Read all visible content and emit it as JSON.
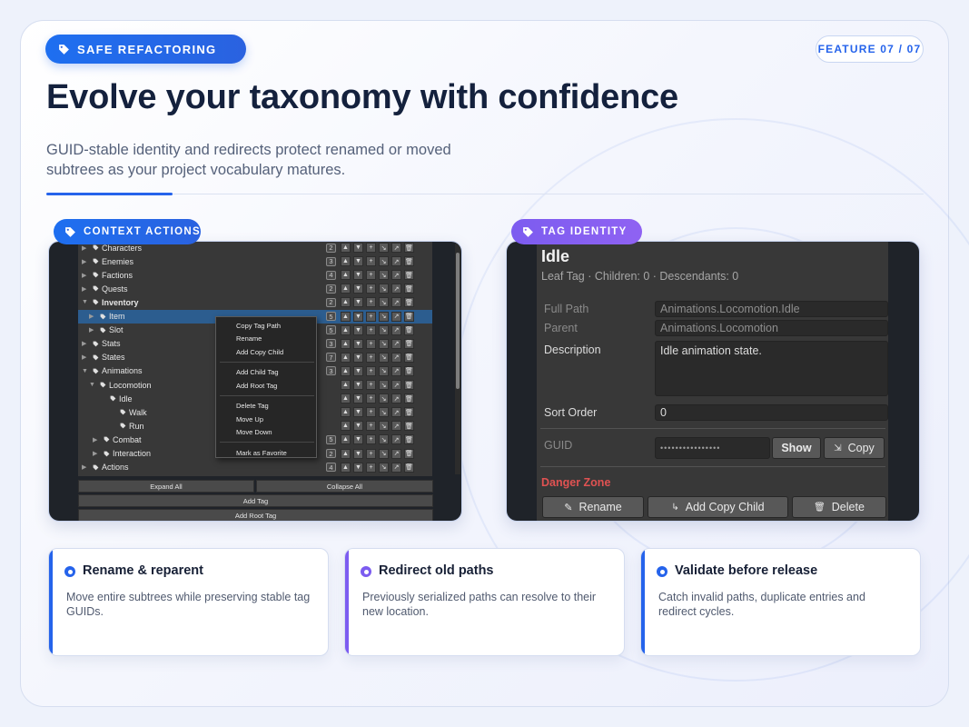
{
  "header": {
    "badge": "SAFE REFACTORING",
    "feature": "FEATURE 07 / 07",
    "title": "Evolve your taxonomy with confidence",
    "subtitle": "GUID-stable identity and redirects protect renamed or moved subtrees as your project vocabulary matures."
  },
  "colors": {
    "accent_blue": "#2563eb",
    "accent_purple": "#7c5cf0",
    "danger": "#e05252"
  },
  "left_panel": {
    "label": "CONTEXT ACTIONS",
    "tree": [
      {
        "name": "Characters",
        "count": "2",
        "arrow": "▶"
      },
      {
        "name": "Enemies",
        "count": "3",
        "arrow": "▶"
      },
      {
        "name": "Factions",
        "count": "4",
        "arrow": "▶"
      },
      {
        "name": "Quests",
        "count": "2",
        "arrow": "▶"
      },
      {
        "name": "Inventory",
        "count": "2",
        "arrow": "▼"
      },
      {
        "name": "Item",
        "count": "5",
        "arrow": "▶"
      },
      {
        "name": "Slot",
        "count": "5",
        "arrow": "▶"
      },
      {
        "name": "Stats",
        "count": "3",
        "arrow": "▶"
      },
      {
        "name": "States",
        "count": "7",
        "arrow": "▶"
      },
      {
        "name": "Animations",
        "count": "3",
        "arrow": "▼"
      },
      {
        "name": "Locomotion",
        "count": "",
        "arrow": "▼"
      },
      {
        "name": "Idle",
        "count": "",
        "arrow": ""
      },
      {
        "name": "Walk",
        "count": "",
        "arrow": ""
      },
      {
        "name": "Run",
        "count": "",
        "arrow": ""
      },
      {
        "name": "Combat",
        "count": "5",
        "arrow": "▶"
      },
      {
        "name": "Interaction",
        "count": "2",
        "arrow": "▶"
      },
      {
        "name": "Actions",
        "count": "4",
        "arrow": "▶"
      }
    ],
    "row_buttons": [
      "▲",
      "▼",
      "+",
      "↘",
      "↗",
      "🗑"
    ],
    "context_menu": [
      "Copy Tag Path",
      "Rename",
      "Add Copy Child",
      "Add Child Tag",
      "Add Root Tag",
      "Delete Tag",
      "Move Up",
      "Move Down",
      "Mark as Favorite"
    ],
    "expand_all": "Expand All",
    "collapse_all": "Collapse All",
    "add_tag": "Add Tag",
    "add_root_tag": "Add Root Tag"
  },
  "right_panel": {
    "label": "TAG IDENTITY",
    "tag_name": "Idle",
    "tag_meta": "Leaf Tag · Children: 0 · Descendants: 0",
    "full_path_label": "Full Path",
    "full_path_value": "Animations.Locomotion.Idle",
    "parent_label": "Parent",
    "parent_value": "Animations.Locomotion",
    "description_label": "Description",
    "description_value": "Idle animation state.",
    "sort_order_label": "Sort Order",
    "sort_order_value": "0",
    "guid_label": "GUID",
    "guid_masked": "••••••••••••••••",
    "show_button": "Show",
    "copy_button": "Copy",
    "danger_zone": "Danger Zone",
    "rename_button": "Rename",
    "add_copy_child_button": "Add Copy Child",
    "delete_button": "Delete"
  },
  "cards": [
    {
      "title": "Rename & reparent",
      "desc": "Move entire subtrees while preserving stable tag GUIDs.",
      "color": "#2563eb"
    },
    {
      "title": "Redirect old paths",
      "desc": "Previously serialized paths can resolve to their new location.",
      "color": "#7c5cf0"
    },
    {
      "title": "Validate before release",
      "desc": "Catch invalid paths, duplicate entries and redirect cycles.",
      "color": "#2563eb"
    }
  ]
}
